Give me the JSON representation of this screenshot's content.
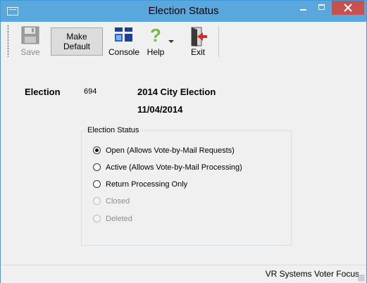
{
  "window": {
    "title": "Election Status"
  },
  "toolbar": {
    "save_label": "Save",
    "default_line1": "Make",
    "default_line2": "Default",
    "console_label": "Console",
    "help_label": "Help",
    "exit_label": "Exit"
  },
  "election": {
    "label": "Election",
    "number": "694",
    "name": "2014 City Election",
    "date": "11/04/2014"
  },
  "status_group": {
    "title": "Election Status",
    "options": [
      {
        "label": "Open (Allows Vote-by-Mail Requests)",
        "checked": true,
        "enabled": true
      },
      {
        "label": "Active (Allows Vote-by-Mail Processing)",
        "checked": false,
        "enabled": true
      },
      {
        "label": "Return Processing Only",
        "checked": false,
        "enabled": true
      },
      {
        "label": "Closed",
        "checked": false,
        "enabled": false
      },
      {
        "label": "Deleted",
        "checked": false,
        "enabled": false
      }
    ]
  },
  "statusbar": {
    "text": "VR Systems Voter Focus"
  },
  "colors": {
    "titlebar": "#5aa7dd",
    "close_button": "#c75050",
    "help_icon": "#6fbd3a",
    "exit_arrow": "#d22b2b"
  }
}
